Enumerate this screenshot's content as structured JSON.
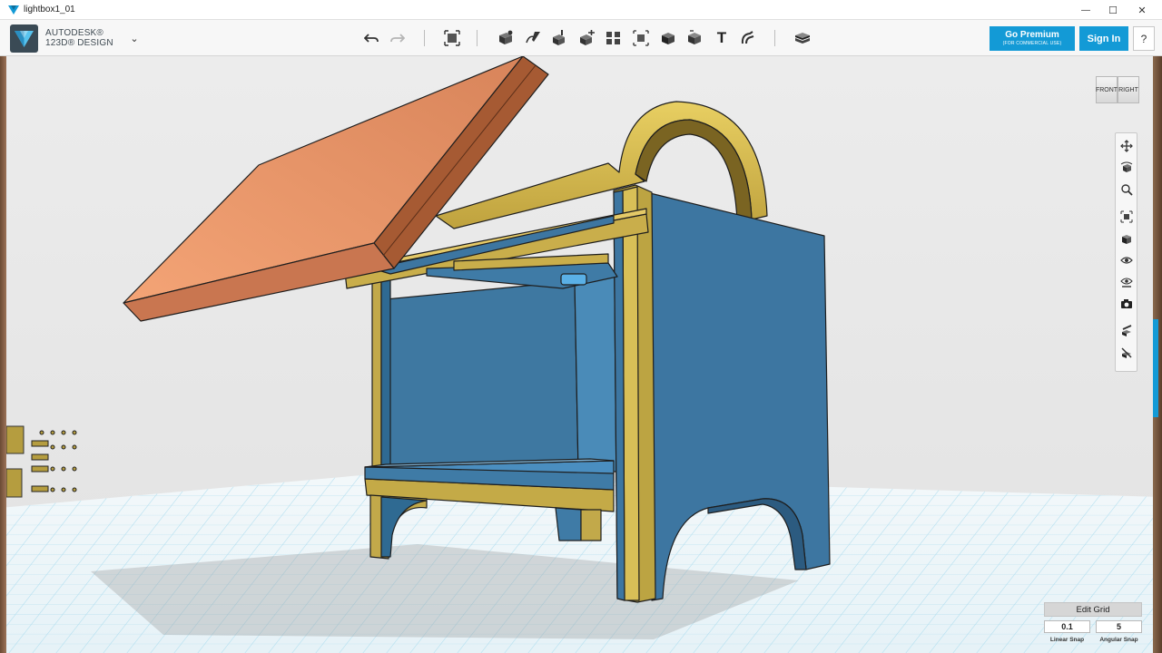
{
  "window": {
    "title": "lightbox1_01",
    "minimize_glyph": "—",
    "maximize_glyph": "☐",
    "close_glyph": "✕"
  },
  "brand": {
    "line1": "AUTODESK®",
    "line2": "123D® DESIGN",
    "menu_glyph": "⌄"
  },
  "toolbar": {
    "tools": [
      {
        "name": "undo-icon"
      },
      {
        "name": "redo-icon"
      },
      {
        "name": "transform-icon"
      },
      {
        "name": "primitives-icon"
      },
      {
        "name": "sketch-icon"
      },
      {
        "name": "construct-icon"
      },
      {
        "name": "modify-icon"
      },
      {
        "name": "pattern-icon"
      },
      {
        "name": "grouping-icon"
      },
      {
        "name": "combine-icon"
      },
      {
        "name": "measure-icon"
      },
      {
        "name": "text-icon"
      },
      {
        "name": "snap-icon"
      },
      {
        "name": "material-icon"
      }
    ],
    "text_tool_glyph": "T"
  },
  "account": {
    "premium_label": "Go Premium",
    "premium_sub": "(FOR COMMERCIAL USE)",
    "signin_label": "Sign In",
    "help_label": "?"
  },
  "viewcube": {
    "front": "FRONT",
    "right": "RIGHT"
  },
  "nav_panel": {
    "buttons": [
      "pan-icon",
      "orbit-icon",
      "zoom-icon",
      "fit-icon",
      "view-mode-icon",
      "visibility-icon",
      "material-visibility-icon",
      "camera-icon",
      "snap-tool-icon",
      "ungroup-tool-icon"
    ]
  },
  "grid": {
    "edit_label": "Edit Grid",
    "linear_snap_value": "0.1",
    "angular_snap_value": "5",
    "linear_snap_label": "Linear Snap",
    "angular_snap_label": "Angular Snap"
  },
  "colors": {
    "accent_blue": "#139ad6",
    "box_blue": "#3f7ba6",
    "frame_gold": "#b59d3f",
    "lid_orange": "#e0885c",
    "grid_line": "#9fd6ec"
  }
}
